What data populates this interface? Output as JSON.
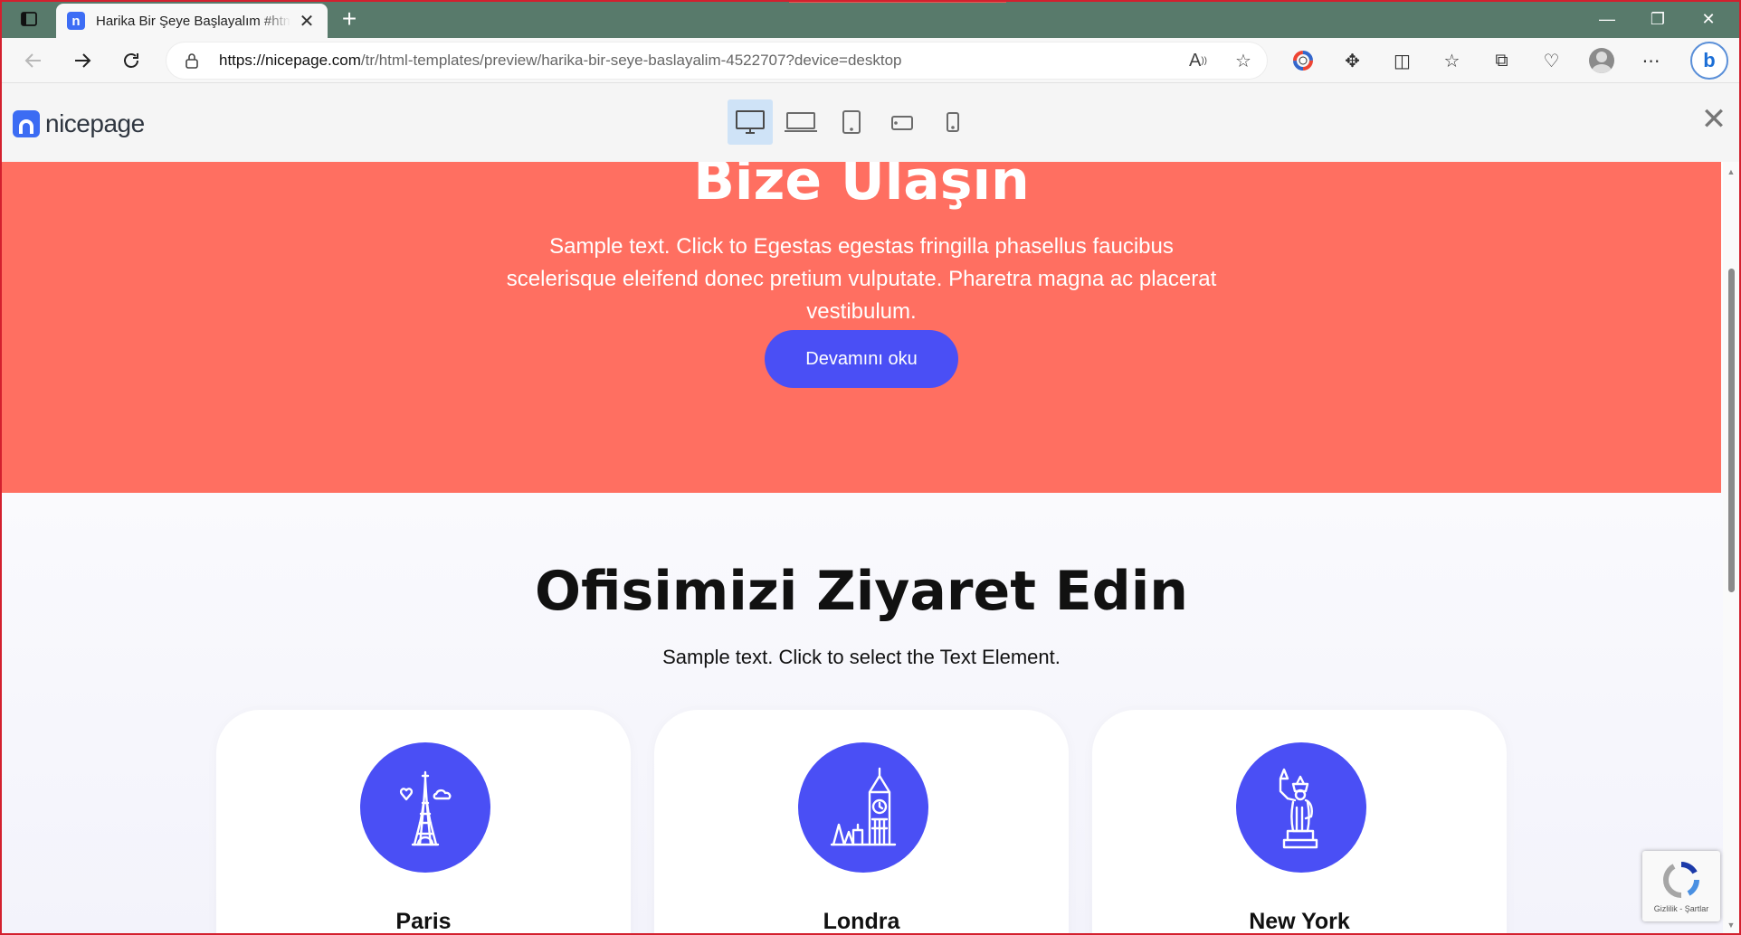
{
  "browser": {
    "tab_title": "Harika Bir Şeye Başlayalım #html",
    "favicon_letter": "n",
    "new_tab": "+",
    "tab_close": "✕",
    "url_host": "https://nicepage.com",
    "url_path": "/tr/html-templates/preview/harika-bir-seye-baslayalim-4522707?device=desktop",
    "window_controls": {
      "minimize": "—",
      "restore": "❐",
      "close": "✕"
    },
    "bing_label": "b"
  },
  "preview_header": {
    "logo_text": "nicepage",
    "close": "✕"
  },
  "hero": {
    "title": "Bize Ulaşın",
    "text": "Sample text. Click to Egestas egestas fringilla phasellus faucibus scelerisque eleifend donec pretium vulputate. Pharetra magna ac placerat vestibulum.",
    "button": "Devamını oku",
    "background": "#ff6f61",
    "button_color": "#4a4ff5"
  },
  "offices": {
    "title": "Ofisimizi Ziyaret Edin",
    "text": "Sample text. Click to select the Text Element.",
    "cards": [
      {
        "city": "Paris",
        "icon": "eiffel-tower-icon"
      },
      {
        "city": "Londra",
        "icon": "big-ben-icon"
      },
      {
        "city": "New York",
        "icon": "statue-of-liberty-icon"
      }
    ]
  },
  "recaptcha": {
    "text": "Gizlilik - Şartlar"
  }
}
